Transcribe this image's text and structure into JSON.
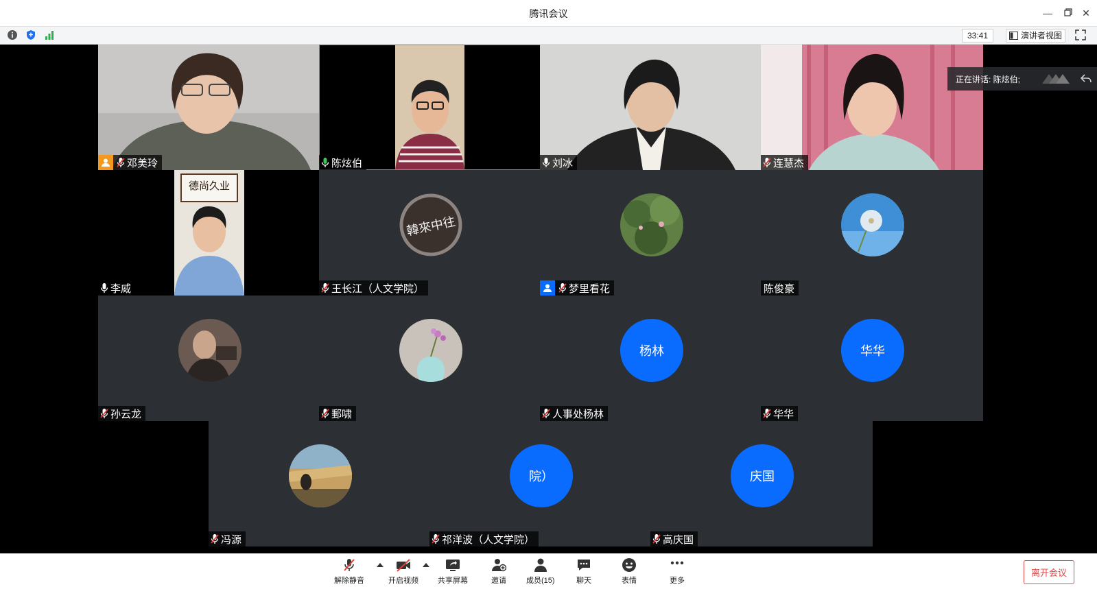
{
  "window": {
    "title": "腾讯会议"
  },
  "infobar": {
    "timer": "33:41",
    "view_label": "演讲者视图"
  },
  "speaking": {
    "label": "正在讲话: 陈炫伯;"
  },
  "participants": [
    {
      "name": "邓美玲",
      "mic": "muted",
      "badge": "host",
      "kind": "video",
      "scene": "woman-glasses"
    },
    {
      "name": "陈炫伯",
      "mic": "active",
      "kind": "video",
      "scene": "man-glasses",
      "active": true
    },
    {
      "name": "刘冰",
      "mic": "on",
      "kind": "video",
      "scene": "woman-bow"
    },
    {
      "name": "连慧杰",
      "mic": "muted",
      "kind": "video",
      "scene": "woman-curtain"
    },
    {
      "name": "李威",
      "mic": "on",
      "kind": "video",
      "scene": "man-calligraphy",
      "calligraphy": "德尚久业"
    },
    {
      "name": "王长江（人文学院）",
      "mic": "muted",
      "kind": "avatar-image",
      "image": "calligraphy-ring",
      "image_text": "韓來中往"
    },
    {
      "name": "梦里看花",
      "mic": "muted",
      "badge": "cohost",
      "kind": "avatar-image",
      "image": "lotus-leaves"
    },
    {
      "name": "陈俊豪",
      "mic": "none",
      "kind": "avatar-image",
      "image": "dandelion"
    },
    {
      "name": "孙云龙",
      "mic": "muted",
      "kind": "avatar-image",
      "image": "old-man-photo"
    },
    {
      "name": "郵啸",
      "mic": "muted",
      "kind": "avatar-image",
      "image": "vase-flowers"
    },
    {
      "name": "人事处杨林",
      "mic": "muted",
      "kind": "avatar-text",
      "avatar_text": "杨林"
    },
    {
      "name": "华华",
      "mic": "muted",
      "kind": "avatar-text",
      "avatar_text": "华华"
    },
    {
      "name": "冯源",
      "mic": "muted",
      "kind": "avatar-image",
      "image": "reeds-landscape"
    },
    {
      "name": "祁洋波（人文学院）",
      "mic": "muted",
      "kind": "avatar-text",
      "avatar_text": "院）"
    },
    {
      "name": "高庆国",
      "mic": "muted",
      "kind": "avatar-text",
      "avatar_text": "庆国"
    }
  ],
  "toolbar": {
    "unmute": "解除静音",
    "video": "开启视频",
    "share": "共享屏幕",
    "invite": "邀请",
    "members": "成员(15)",
    "chat": "聊天",
    "emoji": "表情",
    "more": "更多",
    "leave": "离开会议"
  },
  "colors": {
    "accent": "#0a6cff",
    "leave": "#e14a4a",
    "active_border": "#3ec45d",
    "tile_bg": "#2c2f33"
  }
}
